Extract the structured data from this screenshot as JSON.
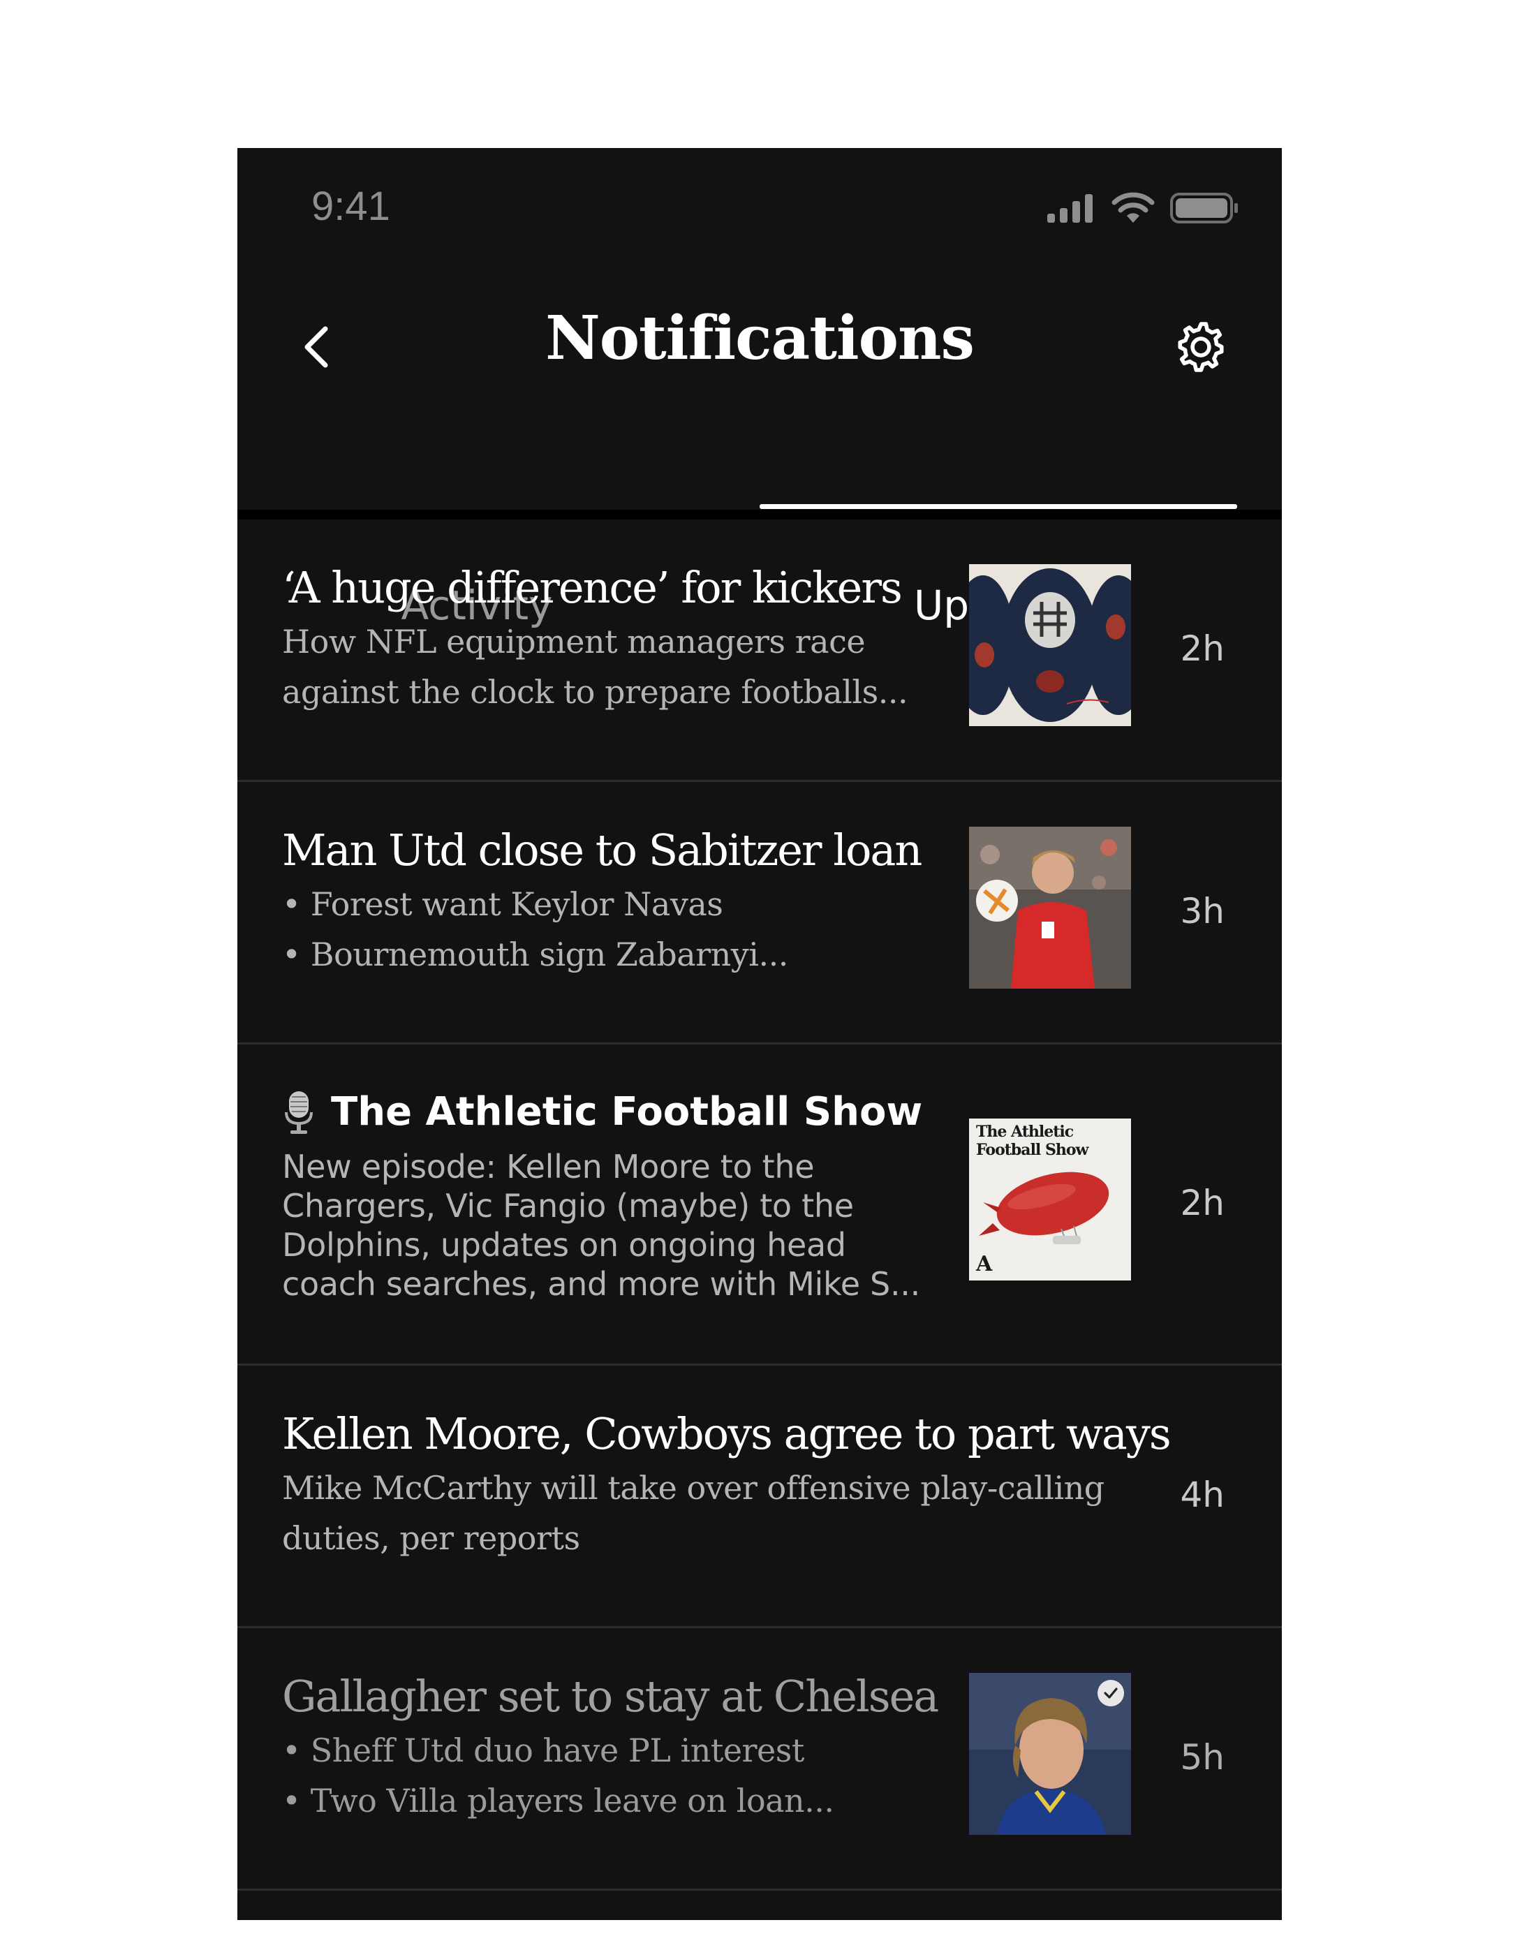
{
  "status_bar": {
    "time": "9:41"
  },
  "header": {
    "title": "Notifications"
  },
  "tabs": [
    {
      "label": "Activity",
      "active": false
    },
    {
      "label": "Updates",
      "active": true
    }
  ],
  "notifications": [
    {
      "headline": "‘A huge difference’ for kickers",
      "lines": [
        "How NFL equipment managers race",
        "against the clock to prepare footballs..."
      ],
      "time": "2h",
      "has_image": true,
      "image": "footballs-helmet-illustration"
    },
    {
      "headline": "Man Utd close to Sabitzer loan",
      "lines": [
        "• Forest want Keylor Navas",
        "• Bournemouth sign Zabarnyi..."
      ],
      "time": "3h",
      "has_image": true,
      "image": "player-in-red-kit-photo"
    },
    {
      "headline": "The Athletic Football Show",
      "icon": "microphone-icon",
      "lines": [
        "New episode: Kellen Moore to the",
        "Chargers, Vic Fangio (maybe) to the",
        "Dolphins, updates on ongoing head",
        "coach searches, and more with Mike S..."
      ],
      "time": "2h",
      "has_image": true,
      "image_text": [
        "The Athletic",
        "Football Show"
      ],
      "image_mark": "A"
    },
    {
      "headline": "Kellen Moore, Cowboys agree to part ways",
      "lines": [
        "Mike McCarthy will take over offensive play-calling",
        "duties, per reports"
      ],
      "time": "4h",
      "has_image": false
    },
    {
      "headline": "Gallagher set to stay at Chelsea",
      "lines": [
        "• Sheff Utd duo have PL interest",
        "• Two Villa players leave on loan..."
      ],
      "time": "5h",
      "has_image": true,
      "image": "player-portrait-photo",
      "read": true
    }
  ],
  "colors": {
    "background": "#121212",
    "divider": "#2d2d2d",
    "text_primary": "#ffffff",
    "text_secondary": "#b5b5b5",
    "tab_inactive": "#9a9a9a"
  }
}
